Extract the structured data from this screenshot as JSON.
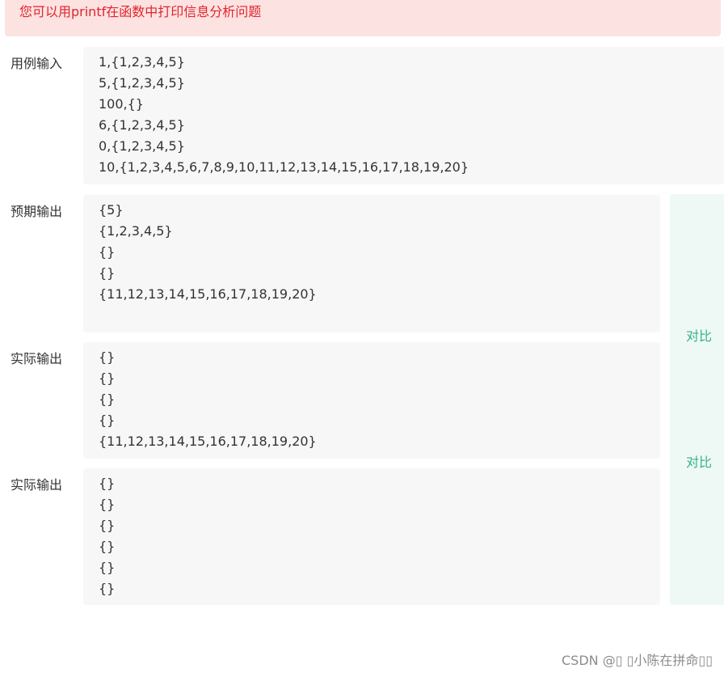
{
  "alert": {
    "text": "您可以用printf在函数中打印信息分析问题"
  },
  "input_section": {
    "label": "用例输入",
    "lines": [
      "1,{1,2,3,4,5}",
      "5,{1,2,3,4,5}",
      "100,{}",
      "6,{1,2,3,4,5}",
      "0,{1,2,3,4,5}",
      "10,{1,2,3,4,5,6,7,8,9,10,11,12,13,14,15,16,17,18,19,20}"
    ]
  },
  "expected_section": {
    "label": "预期输出",
    "lines": [
      "{5}",
      "{1,2,3,4,5}",
      "{}",
      "{}",
      "{11,12,13,14,15,16,17,18,19,20}"
    ]
  },
  "actual_section_1": {
    "label": "实际输出",
    "lines": [
      "{}",
      "{}",
      "{}",
      "{}",
      "{11,12,13,14,15,16,17,18,19,20}"
    ]
  },
  "actual_section_2": {
    "label": "实际输出",
    "lines": [
      "{}",
      "{}",
      "{}",
      "{}",
      "{}",
      "{}"
    ]
  },
  "compare": {
    "button_1": "对比",
    "button_2": "对比"
  },
  "watermark": {
    "text": "CSDN @▯ ▯小陈在拼命▯▯"
  },
  "colors": {
    "alert_bg": "#fde2e2",
    "alert_text": "#e0242b",
    "box_bg": "#f7f7f7",
    "compare_bg": "#eef8f5",
    "compare_text": "#34b482"
  }
}
